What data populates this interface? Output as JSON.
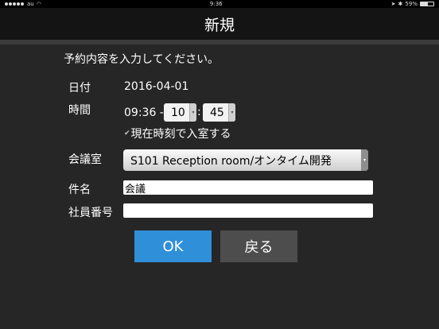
{
  "status_bar": {
    "carrier": "au",
    "time": "9:36",
    "battery": "59%",
    "battery_level": 0.59
  },
  "header": {
    "title": "新規"
  },
  "form": {
    "instruction": "予約内容を入力してください。",
    "date_label": "日付",
    "date_value": "2016-04-01",
    "time_label": "時間",
    "time_start": "09:36 -",
    "hour": "10",
    "colon": ":",
    "minute": "45",
    "checkbox_label": "現在時刻で入室する",
    "room_label": "会議室",
    "room_value": "S101 Reception room/オンタイム開発",
    "subject_label": "件名",
    "subject_value": "会議",
    "employee_label": "社員番号",
    "employee_value": ""
  },
  "buttons": {
    "ok": "OK",
    "back": "戻る"
  },
  "colors": {
    "ok": "#2f8fd8",
    "back": "#4d4d4d",
    "background": "#262626"
  }
}
